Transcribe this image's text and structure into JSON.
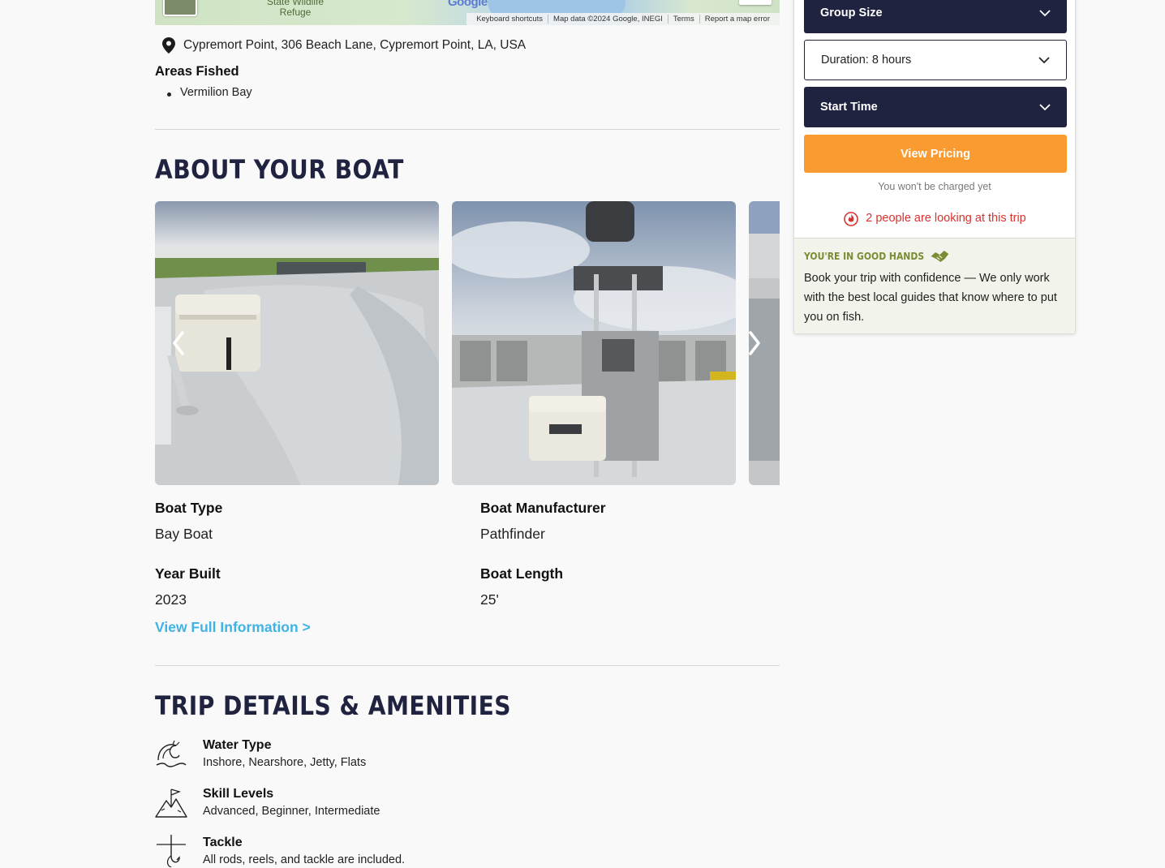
{
  "map": {
    "refuge_line1": "State Wildlife",
    "refuge_line2": "Refuge",
    "google_label": "Google",
    "attribution": [
      "Keyboard shortcuts",
      "Map data ©2024 Google, INEGI",
      "Terms",
      "Report a map error"
    ]
  },
  "location": {
    "address": "Cypremort Point, 306 Beach Lane, Cypremort Point, LA, USA",
    "areas_title": "Areas Fished",
    "areas": [
      "Vermilion Bay"
    ]
  },
  "boat": {
    "heading": "About Your Boat",
    "specs": [
      {
        "label": "Boat Type",
        "value": "Bay Boat"
      },
      {
        "label": "Boat Manufacturer",
        "value": "Pathfinder"
      },
      {
        "label": "Year Built",
        "value": "2023"
      },
      {
        "label": "Boat Length",
        "value": "25'"
      }
    ],
    "full_info_link": "View Full Information >"
  },
  "amenities": {
    "heading": "Trip Details & Amenities",
    "items": [
      {
        "icon": "wave-icon",
        "title": "Water Type",
        "value": "Inshore, Nearshore, Jetty, Flats"
      },
      {
        "icon": "mountain-flag-icon",
        "title": "Skill Levels",
        "value": "Advanced, Beginner, Intermediate"
      },
      {
        "icon": "fish-hook-icon",
        "title": "Tackle",
        "value": "All rods, reels, and tackle are included."
      }
    ]
  },
  "booking": {
    "group_size": "Group Size",
    "duration": "Duration: 8 hours",
    "start_time": "Start Time",
    "cta": "View Pricing",
    "charged_note": "You won't be charged yet",
    "looking": "2 people are looking at this trip",
    "good_hands_title": "You're in good hands",
    "good_hands_text": "Book your trip with confidence — We only work with the best local guides that know where to put you on fish."
  },
  "colors": {
    "navy": "#1f2340",
    "orange": "#f99b30",
    "link_blue": "#3eb3e4",
    "alert_red": "#d8322e",
    "olive": "#7a8c34"
  }
}
